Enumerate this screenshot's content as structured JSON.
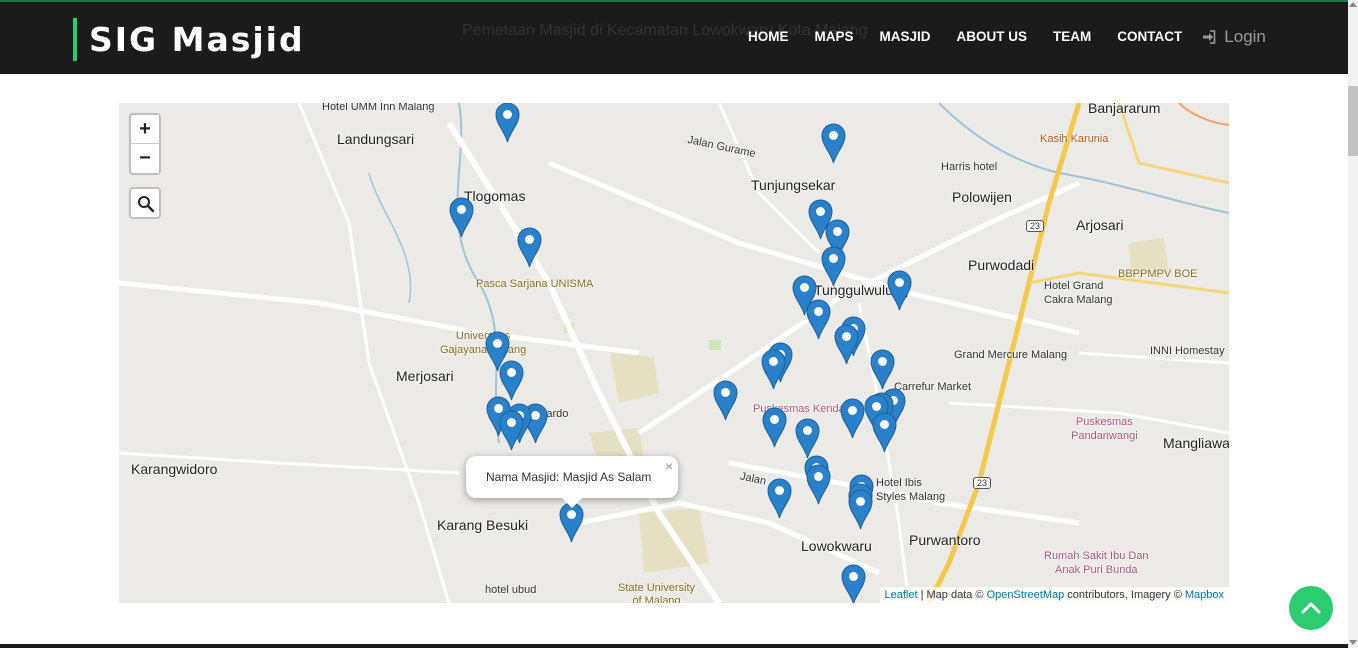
{
  "header": {
    "brand": "SIG Masjid",
    "subtitle": "Pemetaan Masjid di Kecamatan Lowokwaru Kota Malang",
    "nav": [
      "HOME",
      "MAPS",
      "MASJID",
      "ABOUT US",
      "TEAM",
      "CONTACT"
    ],
    "login_label": "Login"
  },
  "map": {
    "zoom_in": "+",
    "zoom_out": "−",
    "popup": {
      "text": "Nama Masjid: Masjid As Salam",
      "close": "×"
    },
    "attribution": {
      "leaflet": "Leaflet",
      "mapdata": " | Map data © ",
      "osm": "OpenStreetMap",
      "contrib": " contributors, Imagery ",
      "copyright": "©",
      "mapbox": "Mapbox"
    },
    "labels": {
      "hotel_umm": "Hotel UMM Inn Malang",
      "landungsari": "Landungsari",
      "tlogomas": "Tlogomas",
      "jalan_gurame": "Jalan Gurame",
      "tunjungsekar": "Tunjungsekar",
      "banjararum": "Banjararum",
      "kasih_karunia": "Kasih Karunia",
      "harris": "Harris hotel",
      "polowijen": "Polowijen",
      "arjosari": "Arjosari",
      "route23a": "23",
      "route23b": "23",
      "purwodadi": "Purwodadi",
      "bbppmpv": "BBPPMPV BOE",
      "hotel_grand_cakra": "Hotel Grand\nCakra Malang",
      "pasca_unisma": "Pasca Sarjana UNISMA",
      "tunggulwulung": "Tunggulwulung",
      "inni": "INNI Homestay",
      "grand_mercure": "Grand Mercure Malang",
      "univ_gajayana": "Universitas\nGajayana Malang",
      "merjosari": "Merjosari",
      "carrefour": "Carrefur Market",
      "sardo": "Sardo",
      "puskesmas_kendal": "Puskesmas Kendal",
      "puskesmas_pandan": "Puskesmas\nPandanwangi",
      "mangliawan": "Mangliawa",
      "karangwidoro": "Karangwidoro",
      "jalan": "Jalan",
      "hotel_ibis": "Hotel Ibis\nStyles Malang",
      "karang_besuki": "Karang Besuki",
      "lowokwaru": "Lowokwaru",
      "purwantoro": "Purwantoro",
      "rs_ibu_anak": "Rumah Sakit Ibu Dan\nAnak Puri Bunda",
      "hotel_ubud": "hotel ubud",
      "state_univ": "State University\nof Malang"
    }
  },
  "colors": {
    "header_bg": "#1b1b1b",
    "brand_bar": "#2ecc71",
    "marker_blue": "#2a81cb",
    "to_top": "#2ecc71",
    "link": "#0078a8"
  },
  "icons": {
    "login": "sign-in-icon",
    "search": "search-icon",
    "marker": "map-marker-icon",
    "to_top": "chevron-up-icon"
  }
}
